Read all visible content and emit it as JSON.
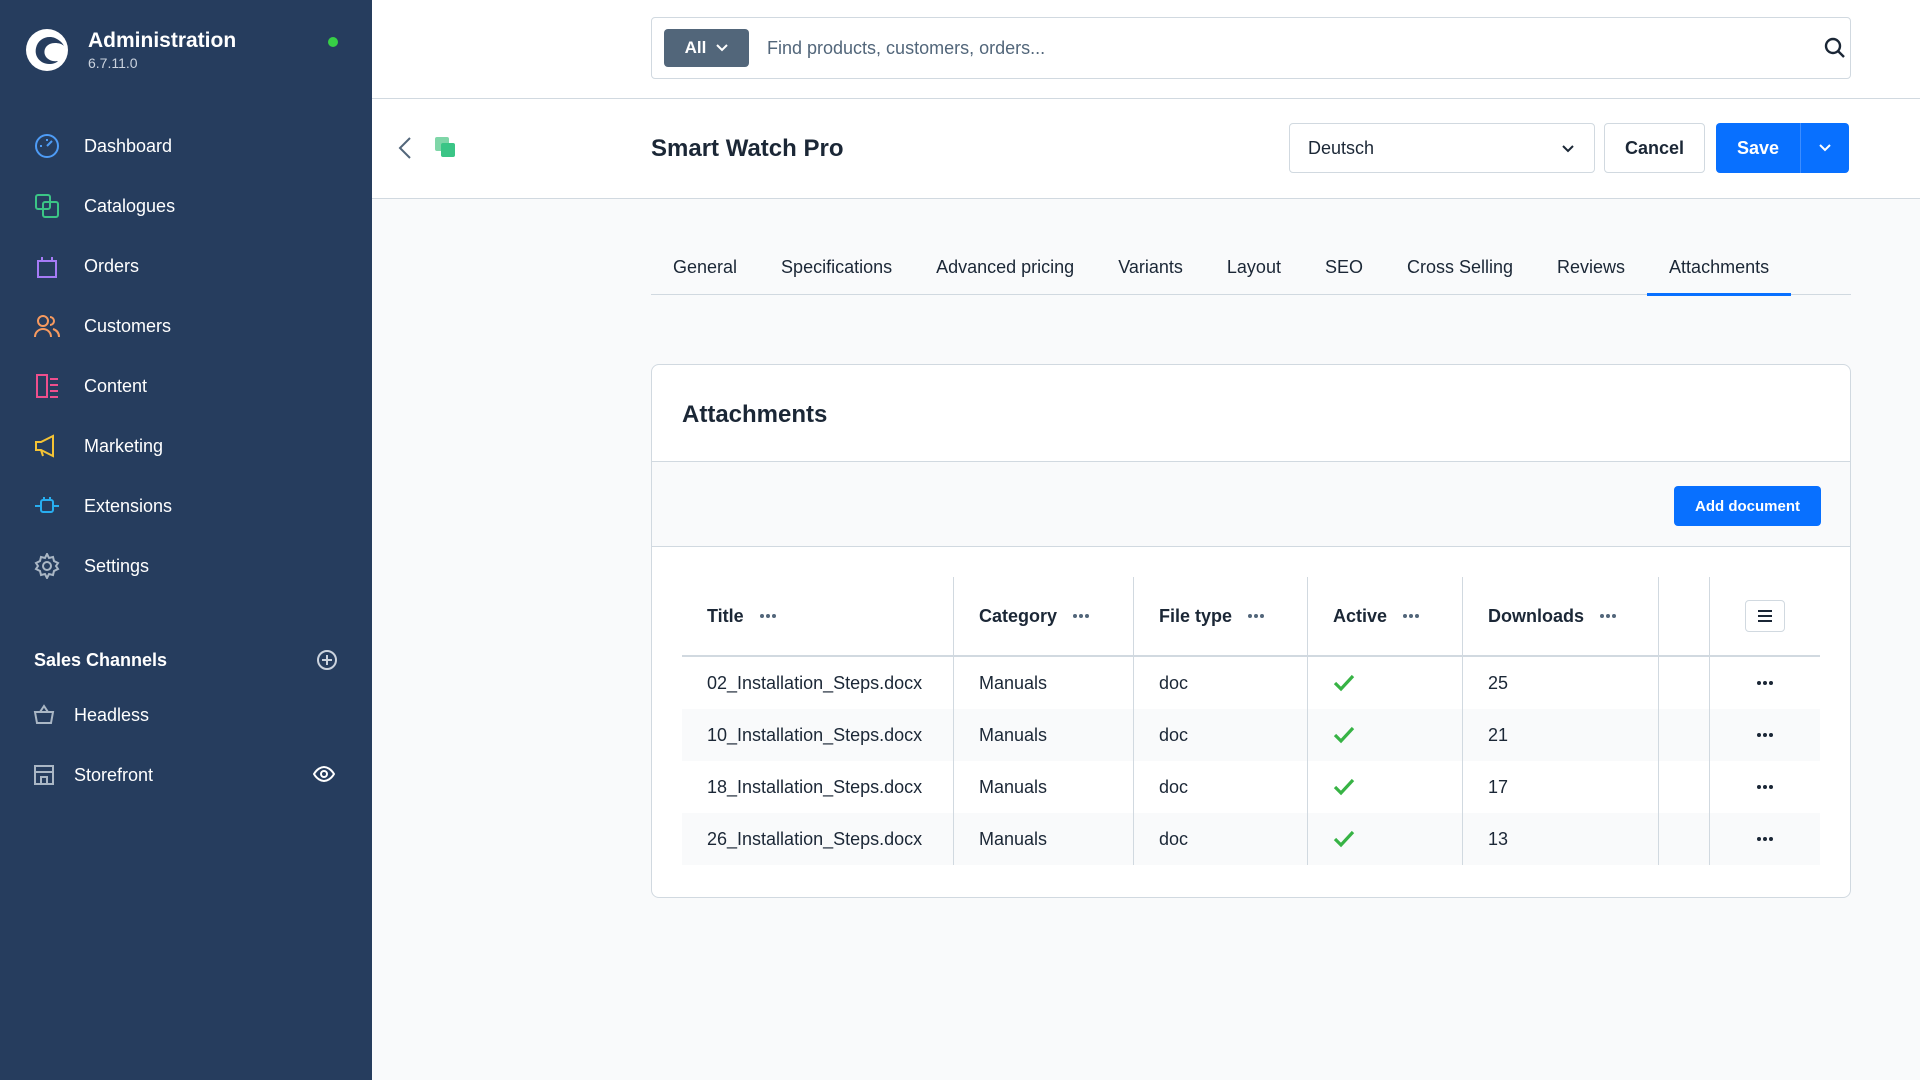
{
  "app": {
    "title": "Administration",
    "version": "6.7.11.0"
  },
  "nav": [
    {
      "label": "Dashboard",
      "icon": "gauge-icon",
      "color": "#4e9cf6"
    },
    {
      "label": "Catalogues",
      "icon": "catalogue-icon",
      "color": "#3bc586"
    },
    {
      "label": "Orders",
      "icon": "bag-icon",
      "color": "#a67bf6"
    },
    {
      "label": "Customers",
      "icon": "users-icon",
      "color": "#f79a5f"
    },
    {
      "label": "Content",
      "icon": "content-icon",
      "color": "#ee4f8d"
    },
    {
      "label": "Marketing",
      "icon": "megaphone-icon",
      "color": "#f5c334"
    },
    {
      "label": "Extensions",
      "icon": "plug-icon",
      "color": "#28aef0"
    },
    {
      "label": "Settings",
      "icon": "gear-icon",
      "color": "#aab7c5"
    }
  ],
  "sales_channels": {
    "title": "Sales Channels",
    "items": [
      {
        "label": "Headless",
        "icon": "basket-icon"
      },
      {
        "label": "Storefront",
        "icon": "storefront-icon"
      }
    ]
  },
  "search": {
    "type_label": "All",
    "placeholder": "Find products, customers, orders..."
  },
  "page": {
    "title": "Smart Watch Pro",
    "language": "Deutsch",
    "cancel_label": "Cancel",
    "save_label": "Save"
  },
  "tabs": [
    {
      "label": "General"
    },
    {
      "label": "Specifications"
    },
    {
      "label": "Advanced pricing"
    },
    {
      "label": "Variants"
    },
    {
      "label": "Layout"
    },
    {
      "label": "SEO"
    },
    {
      "label": "Cross Selling"
    },
    {
      "label": "Reviews"
    },
    {
      "label": "Attachments"
    }
  ],
  "active_tab": "Attachments",
  "attachments": {
    "title": "Attachments",
    "add_label": "Add document",
    "columns": [
      "Title",
      "Category",
      "File type",
      "Active",
      "Downloads"
    ],
    "rows": [
      {
        "title": "02_Installation_Steps.docx",
        "category": "Manuals",
        "file_type": "doc",
        "active": true,
        "downloads": "25"
      },
      {
        "title": "10_Installation_Steps.docx",
        "category": "Manuals",
        "file_type": "doc",
        "active": true,
        "downloads": "21"
      },
      {
        "title": "18_Installation_Steps.docx",
        "category": "Manuals",
        "file_type": "doc",
        "active": true,
        "downloads": "17"
      },
      {
        "title": "26_Installation_Steps.docx",
        "category": "Manuals",
        "file_type": "doc",
        "active": true,
        "downloads": "13"
      }
    ]
  },
  "colors": {
    "sidebar": "#263d5e",
    "primary": "#0870ff",
    "success": "#37b345",
    "status_online": "#37d046"
  }
}
